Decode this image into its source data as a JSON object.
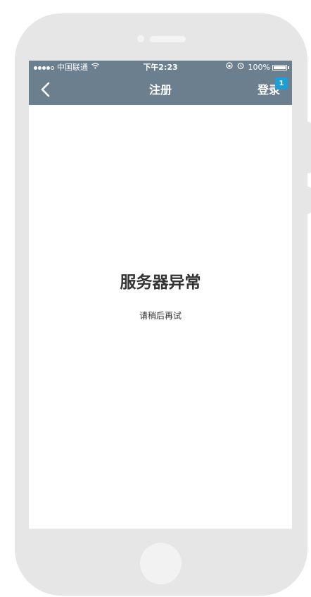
{
  "status_bar": {
    "carrier": "中国联通",
    "time": "下午2:23",
    "battery": "100%"
  },
  "nav": {
    "title": "注册",
    "login_label": "登录",
    "badge_count": "1"
  },
  "error": {
    "title": "服务器异常",
    "message": "请稍后再试"
  },
  "colors": {
    "header_bg": "#6c7f8e",
    "badge_bg": "#1a9fd9",
    "phone_frame": "#e6e6e6"
  }
}
